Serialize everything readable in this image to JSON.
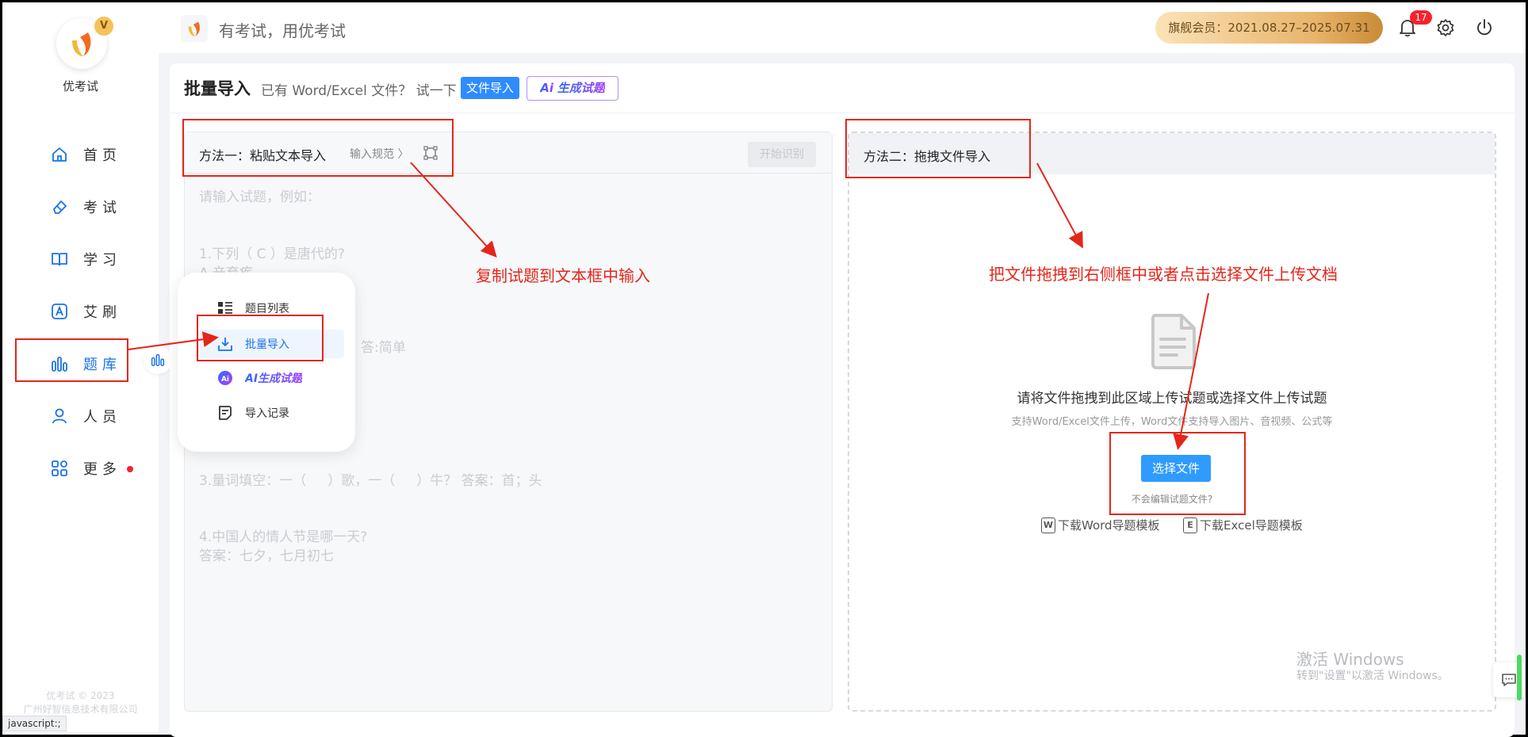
{
  "sidebar": {
    "app_name": "优考试",
    "logo_badge": "V",
    "items": [
      {
        "label": "首页",
        "icon": "home-icon"
      },
      {
        "label": "考试",
        "icon": "eraser-icon"
      },
      {
        "label": "学习",
        "icon": "book-icon"
      },
      {
        "label": "艾刷",
        "icon": "letter-a-icon"
      },
      {
        "label": "题库",
        "icon": "bar-chart-icon",
        "active": true
      },
      {
        "label": "人员",
        "icon": "user-icon"
      },
      {
        "label": "更多",
        "icon": "apps-icon",
        "has_dot": true
      }
    ],
    "copyright_line1": "优考试 © 2023",
    "copyright_line2": "广州好智信息技术有限公司"
  },
  "status_bar": "javascript:;",
  "popover": {
    "items": [
      {
        "label": "题目列表",
        "icon": "list-icon"
      },
      {
        "label": "批量导入",
        "icon": "download-icon",
        "active": true
      },
      {
        "label": "AI生成试题",
        "icon": "ai-icon"
      },
      {
        "label": "导入记录",
        "icon": "record-icon"
      }
    ]
  },
  "topbar": {
    "slogan": "有考试，用优考试",
    "vip_label": "旗舰会员：2021.08.27–2025.07.31",
    "notification_count": "17"
  },
  "page": {
    "title": "批量导入",
    "subtitle": "已有 Word/Excel 文件？ 试一下",
    "file_import_button": "文件导入",
    "ai_button_prefix": "Ai",
    "ai_button_label": "生成试题"
  },
  "method1": {
    "title": "方法一：粘贴文本导入",
    "rule_link": "输入规范 〉",
    "recognize_button": "开始识别",
    "placeholder_lines": [
      "请输入试题，例如：",
      "1.下列（ C ）是唐代的?",
      "A.辛弃疾",
      "答:简单",
      "3.量词填空：一（     ）歌，一（     ）牛？ 答案：首；头",
      "4.中国人的情人节是哪一天?",
      "答案：七夕，七月初七"
    ]
  },
  "method2": {
    "title": "方法二：拖拽文件导入",
    "drop_text": "请将文件拖拽到此区域上传试题或选择文件上传试题",
    "drop_sub": "支持Word/Excel文件上传，Word文件支持导入图片、音视频、公式等",
    "select_button": "选择文件",
    "help_link": "不会编辑试题文件?",
    "word_badge": "W",
    "word_template": "下载Word导题模板",
    "excel_badge": "E",
    "excel_template": "下载Excel导题模板"
  },
  "watermark": {
    "line1": "激活 Windows",
    "line2": "转到\"设置\"以激活 Windows。"
  },
  "annotations": {
    "left_note": "复制试题到文本框中输入",
    "right_note": "把文件拖拽到右侧框中或者点击选择文件上传文档"
  },
  "colors": {
    "accent": "#2f8cff",
    "annotation_red": "#e4261b",
    "vip_gold": "#e8b46a",
    "badge_red": "#f5222d"
  }
}
